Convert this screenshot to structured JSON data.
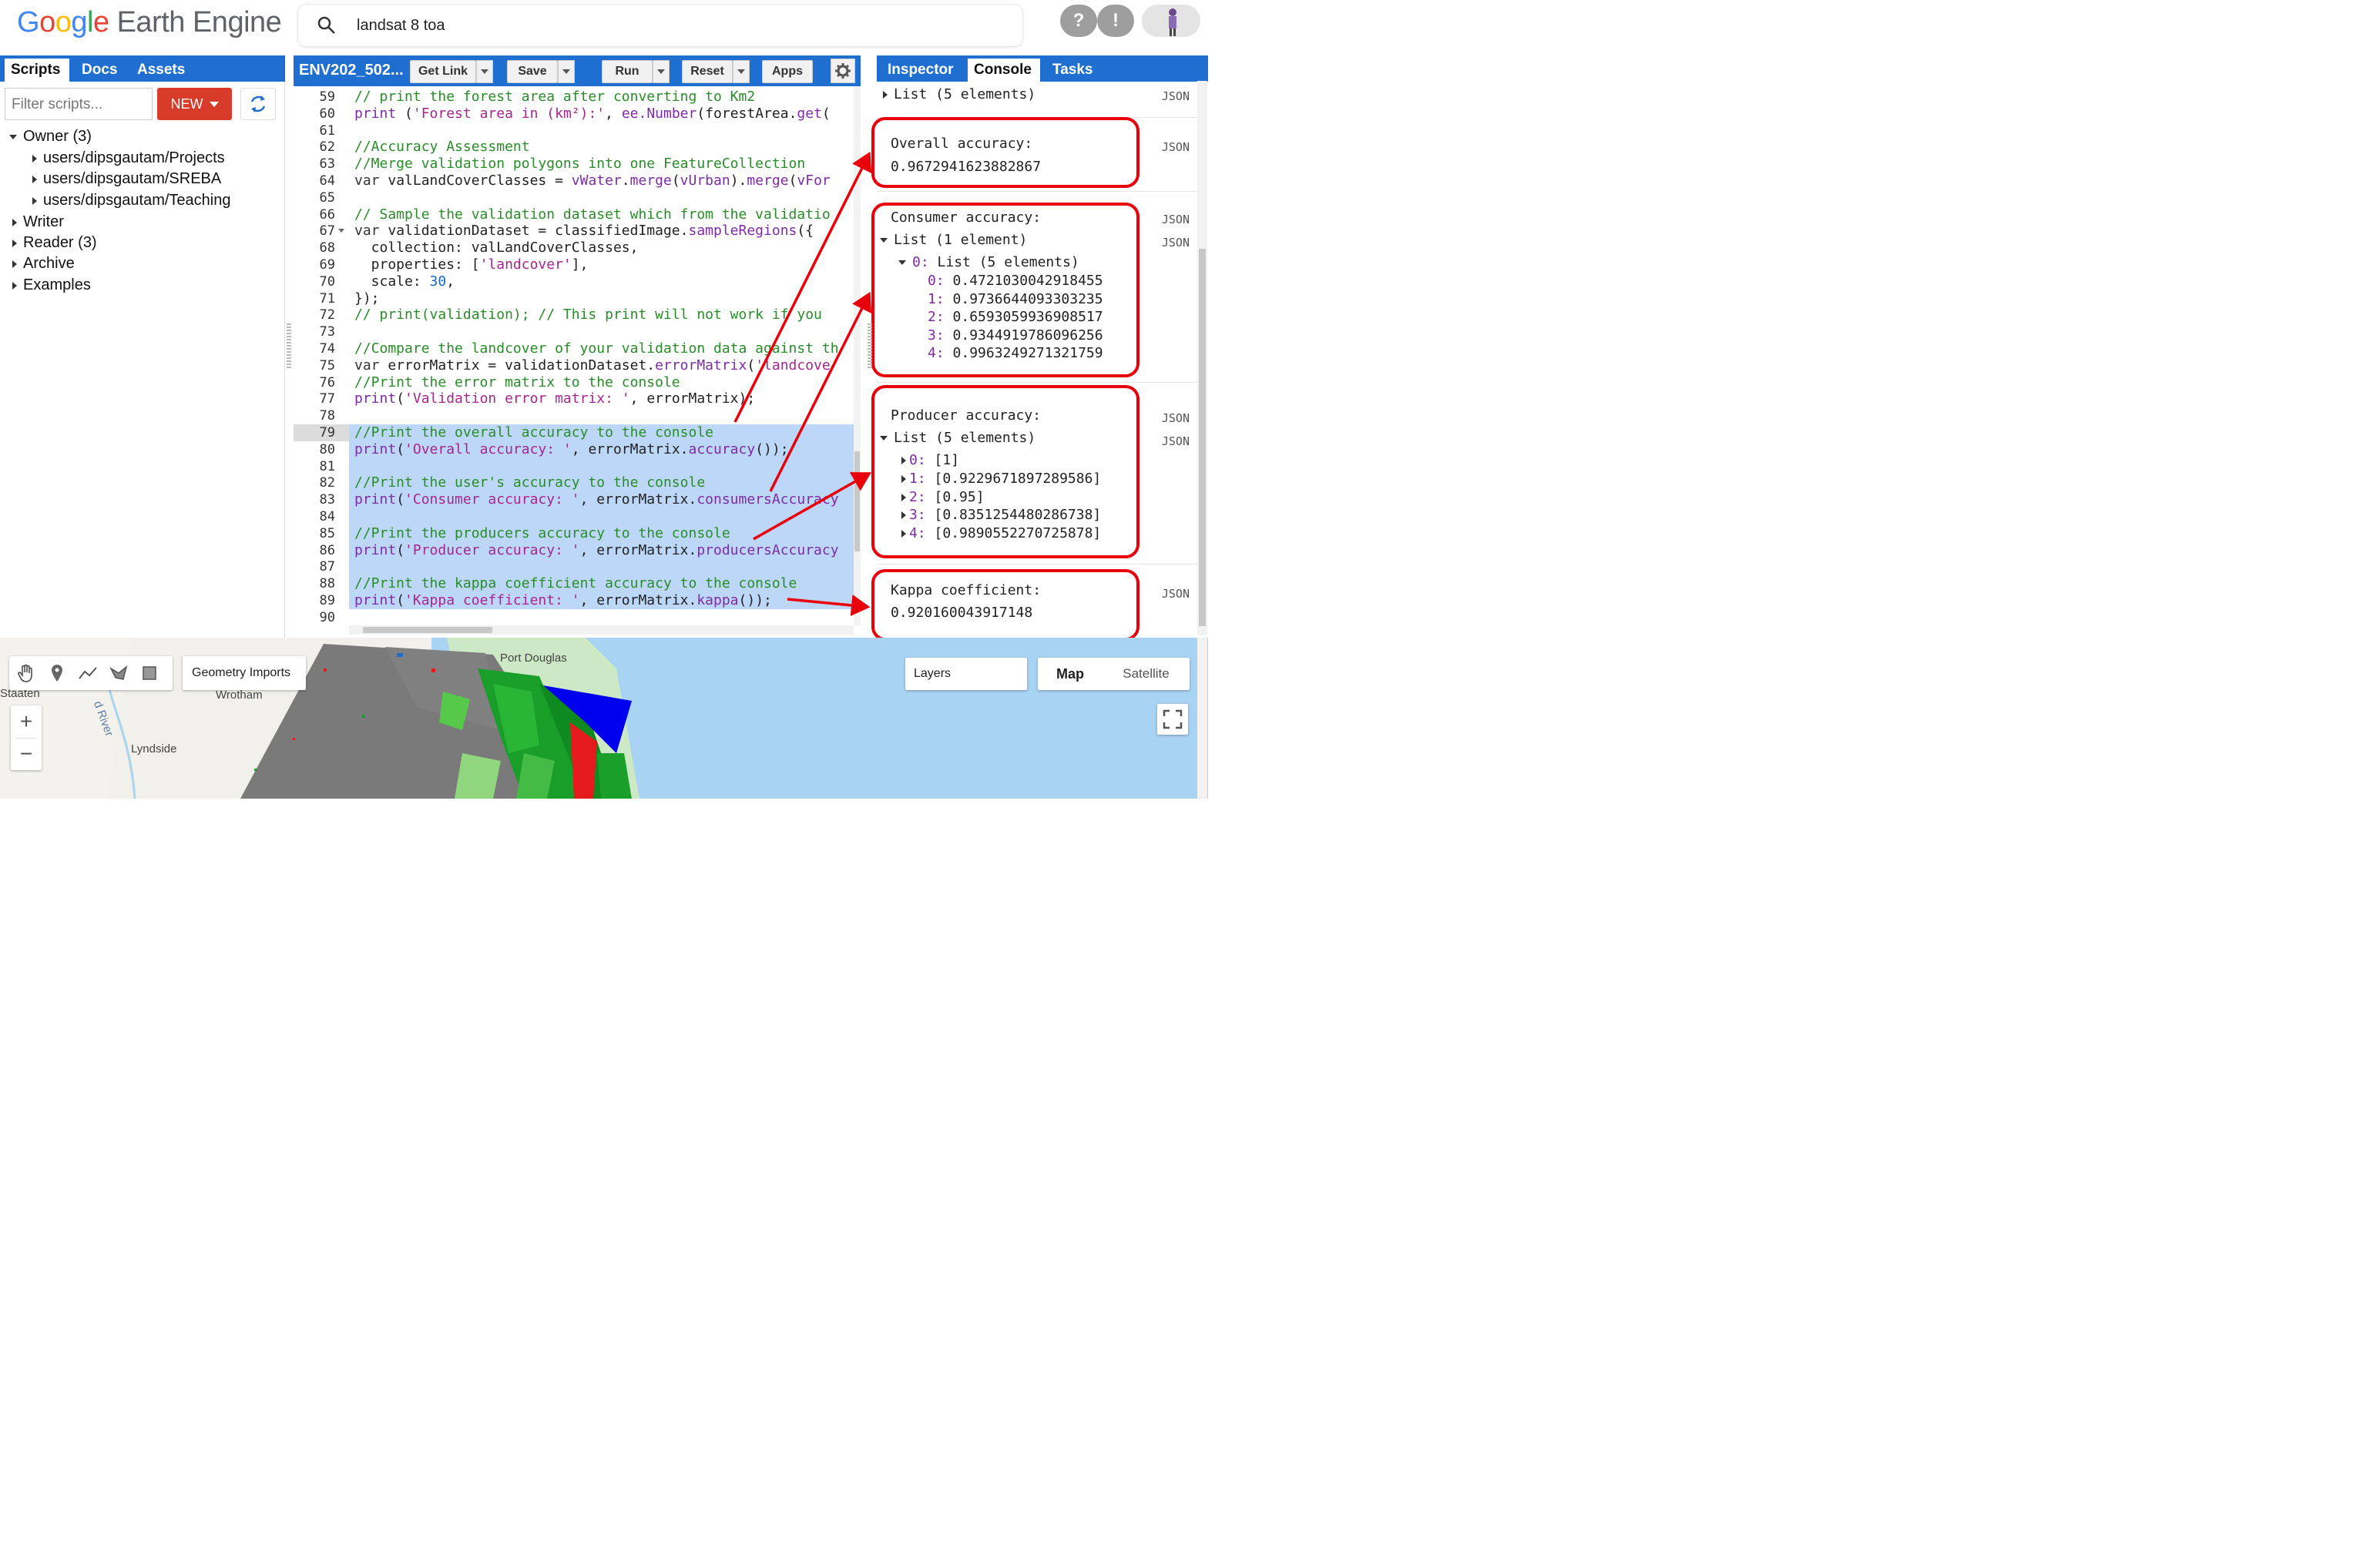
{
  "header": {
    "logo_google": [
      "G",
      "o",
      "o",
      "g",
      "l",
      "e"
    ],
    "logo_rest": "Earth Engine",
    "search_value": "landsat 8 toa",
    "help_icon": "?",
    "notifications_icon": "!"
  },
  "left_panel": {
    "tabs": [
      "Scripts",
      "Docs",
      "Assets"
    ],
    "filter_placeholder": "Filter scripts...",
    "new_button": "NEW",
    "tree": [
      {
        "label": "Owner (3)",
        "expanded": true,
        "level": 0
      },
      {
        "label": "users/dipsgautam/Projects",
        "expanded": false,
        "level": 1
      },
      {
        "label": "users/dipsgautam/SREBA",
        "expanded": false,
        "level": 1
      },
      {
        "label": "users/dipsgautam/Teaching",
        "expanded": false,
        "level": 1
      },
      {
        "label": "Writer",
        "expanded": false,
        "level": 0
      },
      {
        "label": "Reader (3)",
        "expanded": false,
        "level": 0
      },
      {
        "label": "Archive",
        "expanded": false,
        "level": 0
      },
      {
        "label": "Examples",
        "expanded": false,
        "level": 0
      }
    ]
  },
  "editor": {
    "filename": "ENV202_502...",
    "buttons": {
      "get_link": "Get Link",
      "save": "Save",
      "run": "Run",
      "reset": "Reset",
      "apps": "Apps"
    },
    "highlighted_lines": [
      79,
      80,
      81,
      82,
      83,
      84,
      85,
      86,
      87,
      88,
      89
    ],
    "lines": [
      {
        "n": "59",
        "segs": [
          [
            "cm",
            "// print the forest area after converting to Km2"
          ]
        ]
      },
      {
        "n": "60",
        "segs": [
          [
            "fn",
            "print"
          ],
          [
            "pl",
            " ("
          ],
          [
            "st",
            "'Forest area in (km²):'"
          ],
          [
            "pl",
            ", "
          ],
          [
            "fn",
            "ee.Number"
          ],
          [
            "pl",
            "(forestArea."
          ],
          [
            "fn",
            "get"
          ],
          [
            "pl",
            "("
          ]
        ]
      },
      {
        "n": "61",
        "segs": []
      },
      {
        "n": "62",
        "segs": [
          [
            "cm",
            "//Accuracy Assessment"
          ]
        ]
      },
      {
        "n": "63",
        "segs": [
          [
            "cm",
            "//Merge validation polygons into one FeatureCollection"
          ]
        ]
      },
      {
        "n": "64",
        "segs": [
          [
            "kw",
            "var"
          ],
          [
            "pl",
            " valLandCoverClasses = "
          ],
          [
            "fn",
            "vWater"
          ],
          [
            "pl",
            "."
          ],
          [
            "fn",
            "merge"
          ],
          [
            "pl",
            "("
          ],
          [
            "fn",
            "vUrban"
          ],
          [
            "pl",
            ")."
          ],
          [
            "fn",
            "merge"
          ],
          [
            "pl",
            "("
          ],
          [
            "fn",
            "vFor"
          ]
        ]
      },
      {
        "n": "65",
        "segs": []
      },
      {
        "n": "66",
        "segs": [
          [
            "cm",
            "// Sample the validation dataset which from the validatio"
          ]
        ]
      },
      {
        "n": "67",
        "segs": [
          [
            "kw",
            "var"
          ],
          [
            "pl",
            " validationDataset = classifiedImage."
          ],
          [
            "fn",
            "sampleRegions"
          ],
          [
            "pl",
            "({"
          ]
        ]
      },
      {
        "n": "68",
        "segs": [
          [
            "pl",
            "  collection: valLandCoverClasses,"
          ]
        ]
      },
      {
        "n": "69",
        "segs": [
          [
            "pl",
            "  properties: ["
          ],
          [
            "st",
            "'landcover'"
          ],
          [
            "pl",
            "],"
          ]
        ]
      },
      {
        "n": "70",
        "segs": [
          [
            "pl",
            "  scale: "
          ],
          [
            "nm",
            "30"
          ],
          [
            "pl",
            ","
          ]
        ]
      },
      {
        "n": "71",
        "segs": [
          [
            "pl",
            "});"
          ]
        ]
      },
      {
        "n": "72",
        "segs": [
          [
            "cm",
            "// print(validation); // This print will not work if you "
          ]
        ]
      },
      {
        "n": "73",
        "segs": []
      },
      {
        "n": "74",
        "segs": [
          [
            "cm",
            "//Compare the landcover of your validation data against th"
          ]
        ]
      },
      {
        "n": "75",
        "segs": [
          [
            "kw",
            "var"
          ],
          [
            "pl",
            " errorMatrix = validationDataset."
          ],
          [
            "fn",
            "errorMatrix"
          ],
          [
            "pl",
            "("
          ],
          [
            "st",
            "'landcove"
          ]
        ]
      },
      {
        "n": "76",
        "segs": [
          [
            "cm",
            "//Print the error matrix to the console"
          ]
        ]
      },
      {
        "n": "77",
        "segs": [
          [
            "fn",
            "print"
          ],
          [
            "pl",
            "("
          ],
          [
            "st",
            "'Validation error matrix: '"
          ],
          [
            "pl",
            ", errorMatrix);"
          ]
        ]
      },
      {
        "n": "78",
        "segs": []
      },
      {
        "n": "79",
        "segs": [
          [
            "cm",
            "//Print the overall accuracy to the console"
          ]
        ]
      },
      {
        "n": "80",
        "segs": [
          [
            "fn",
            "print"
          ],
          [
            "pl",
            "("
          ],
          [
            "st",
            "'Overall accuracy: '"
          ],
          [
            "pl",
            ", errorMatrix."
          ],
          [
            "fn",
            "accuracy"
          ],
          [
            "pl",
            "());"
          ]
        ]
      },
      {
        "n": "81",
        "segs": []
      },
      {
        "n": "82",
        "segs": [
          [
            "cm",
            "//Print the user's accuracy to the console"
          ]
        ]
      },
      {
        "n": "83",
        "segs": [
          [
            "fn",
            "print"
          ],
          [
            "pl",
            "("
          ],
          [
            "st",
            "'Consumer accuracy: '"
          ],
          [
            "pl",
            ", errorMatrix."
          ],
          [
            "fn",
            "consumersAccuracy"
          ]
        ]
      },
      {
        "n": "84",
        "segs": []
      },
      {
        "n": "85",
        "segs": [
          [
            "cm",
            "//Print the producers accuracy to the console"
          ]
        ]
      },
      {
        "n": "86",
        "segs": [
          [
            "fn",
            "print"
          ],
          [
            "pl",
            "("
          ],
          [
            "st",
            "'Producer accuracy: '"
          ],
          [
            "pl",
            ", errorMatrix."
          ],
          [
            "fn",
            "producersAccuracy"
          ]
        ]
      },
      {
        "n": "87",
        "segs": []
      },
      {
        "n": "88",
        "segs": [
          [
            "cm",
            "//Print the kappa coefficient accuracy to the console"
          ]
        ]
      },
      {
        "n": "89",
        "segs": [
          [
            "fn",
            "print"
          ],
          [
            "pl",
            "("
          ],
          [
            "st",
            "'Kappa coefficient: '"
          ],
          [
            "pl",
            ", errorMatrix."
          ],
          [
            "fn",
            "kappa"
          ],
          [
            "pl",
            "());"
          ]
        ]
      },
      {
        "n": "90",
        "segs": []
      }
    ]
  },
  "right_panel": {
    "tabs": [
      "Inspector",
      "Console",
      "Tasks"
    ],
    "json_label": "JSON",
    "top_list": "List (5 elements)",
    "overall": {
      "label": "Overall accuracy:",
      "value": "0.9672941623882867"
    },
    "consumer": {
      "label": "Consumer accuracy:",
      "list": "List (1 element)",
      "sub_index": "0:",
      "sub_list": "List (5 elements)",
      "items": [
        {
          "i": "0:",
          "v": "0.4721030042918455"
        },
        {
          "i": "1:",
          "v": "0.9736644093303235"
        },
        {
          "i": "2:",
          "v": "0.6593059936908517"
        },
        {
          "i": "3:",
          "v": "0.9344919786096256"
        },
        {
          "i": "4:",
          "v": "0.9963249271321759"
        }
      ]
    },
    "producer": {
      "label": "Producer accuracy:",
      "list": "List (5 elements)",
      "items": [
        {
          "i": "0:",
          "v": "[1]"
        },
        {
          "i": "1:",
          "v": "[0.9229671897289586]"
        },
        {
          "i": "2:",
          "v": "[0.95]"
        },
        {
          "i": "3:",
          "v": "[0.8351254480286738]"
        },
        {
          "i": "4:",
          "v": "[0.9890552270725878]"
        }
      ]
    },
    "kappa": {
      "label": "Kappa coefficient:",
      "value": "0.920160043917148"
    }
  },
  "map": {
    "geometry_imports": "Geometry Imports",
    "layers": "Layers",
    "map_tab": "Map",
    "satellite_tab": "Satellite",
    "labels": [
      "Port Douglas",
      "Staaten",
      "Wrotham",
      "Lyndside",
      "d River"
    ],
    "zoom_in": "+",
    "zoom_out": "−"
  },
  "colors": {
    "accent_blue": "#1f6fd1",
    "new_red": "#d93b2b",
    "annotation_red": "#e8000a",
    "highlight": "#bcd7f8"
  }
}
